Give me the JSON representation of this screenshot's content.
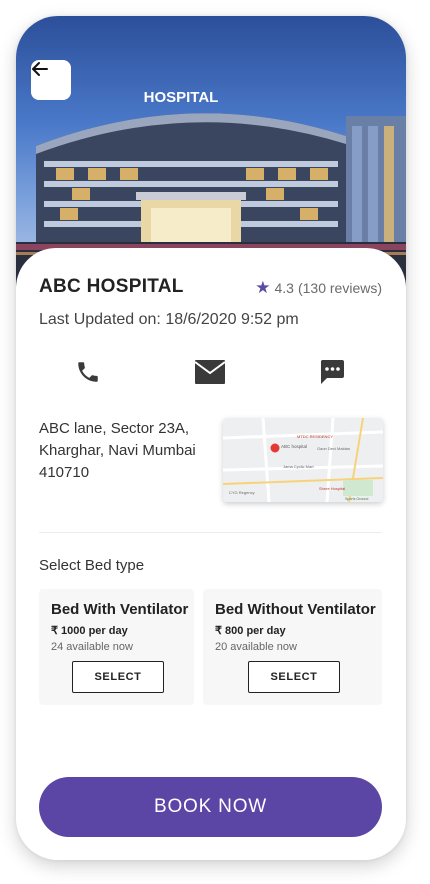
{
  "hero": {
    "sign_text": "HOSPITAL",
    "back_icon": "arrow-left-icon"
  },
  "hospital": {
    "name": "ABC HOSPITAL",
    "rating": "4.3",
    "reviews": "(130 reviews)",
    "last_updated": "Last Updated on: 18/6/2020 9:52 pm",
    "address_lines": [
      "ABC lane, Sector 23A,",
      "Kharghar, Navi Mumbai",
      "410710"
    ]
  },
  "contact_icons": [
    "phone-icon",
    "mail-icon",
    "chat-icon"
  ],
  "map": {
    "labels": [
      "MTDC RESIDENCY",
      "ABC hospital",
      "Gaon Devi Maidan",
      "Jama Cyclic Mart",
      "Shree Hospital",
      "CYG Regency",
      "Sports Ground"
    ]
  },
  "bed_section": {
    "label": "Select Bed type",
    "options": [
      {
        "name": "Bed With Ventilator",
        "price": "₹ 1000 per day",
        "availability": "24 available now",
        "button": "SELECT"
      },
      {
        "name": "Bed Without Ventilator",
        "price": "₹ 800 per day",
        "availability": "20 available now",
        "button": "SELECT"
      }
    ]
  },
  "book_button": "BOOK NOW",
  "colors": {
    "accent": "#5b46a6",
    "star": "#5b4aa6",
    "map_pin": "#e53935"
  }
}
